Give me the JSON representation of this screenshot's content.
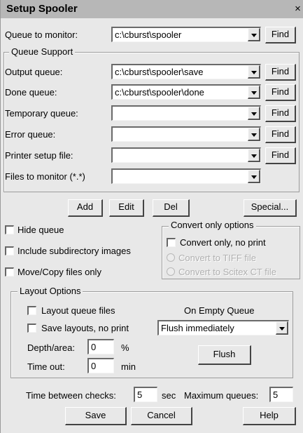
{
  "window": {
    "title": "Setup Spooler",
    "close_glyph": "×"
  },
  "queue_to_monitor": {
    "label": "Queue to monitor:",
    "value": "c:\\cburst\\spooler",
    "find": "Find"
  },
  "queue_support": {
    "legend": "Queue Support",
    "rows": [
      {
        "label": "Output queue:",
        "value": "c:\\cburst\\spooler\\save",
        "find": "Find"
      },
      {
        "label": "Done queue:",
        "value": "c:\\cburst\\spooler\\done",
        "find": "Find"
      },
      {
        "label": "Temporary queue:",
        "value": "",
        "find": "Find"
      },
      {
        "label": "Error queue:",
        "value": "",
        "find": "Find"
      },
      {
        "label": "Printer setup file:",
        "value": "",
        "find": "Find"
      },
      {
        "label": "Files to monitor (*.*)",
        "value": ""
      }
    ]
  },
  "actions": {
    "add": "Add",
    "edit": "Edit",
    "del": "Del",
    "special": "Special..."
  },
  "options": {
    "hide_queue": "Hide queue",
    "include_subdir": "Include subdirectory images",
    "move_copy": "Move/Copy files only"
  },
  "convert": {
    "legend": "Convert only options",
    "convert_only": "Convert only, no print",
    "to_tiff": "Convert to TIFF file",
    "to_scitex": "Convert to Scitex CT file"
  },
  "layout": {
    "legend": "Layout Options",
    "layout_queue_files": "Layout queue files",
    "save_layouts": "Save layouts, no print",
    "depth_label": "Depth/area:",
    "depth_value": "0",
    "depth_unit": "%",
    "timeout_label": "Time out:",
    "timeout_value": "0",
    "timeout_unit": "min",
    "on_empty_label": "On Empty Queue",
    "on_empty_value": "Flush immediately",
    "flush": "Flush"
  },
  "footer": {
    "time_between_label": "Time between checks:",
    "time_between_value": "5",
    "time_between_unit": "sec",
    "max_queues_label": "Maximum queues:",
    "max_queues_value": "5",
    "save": "Save",
    "cancel": "Cancel",
    "help": "Help"
  },
  "icons": {
    "close": "close-icon",
    "dropdown": "chevron-down-icon"
  }
}
